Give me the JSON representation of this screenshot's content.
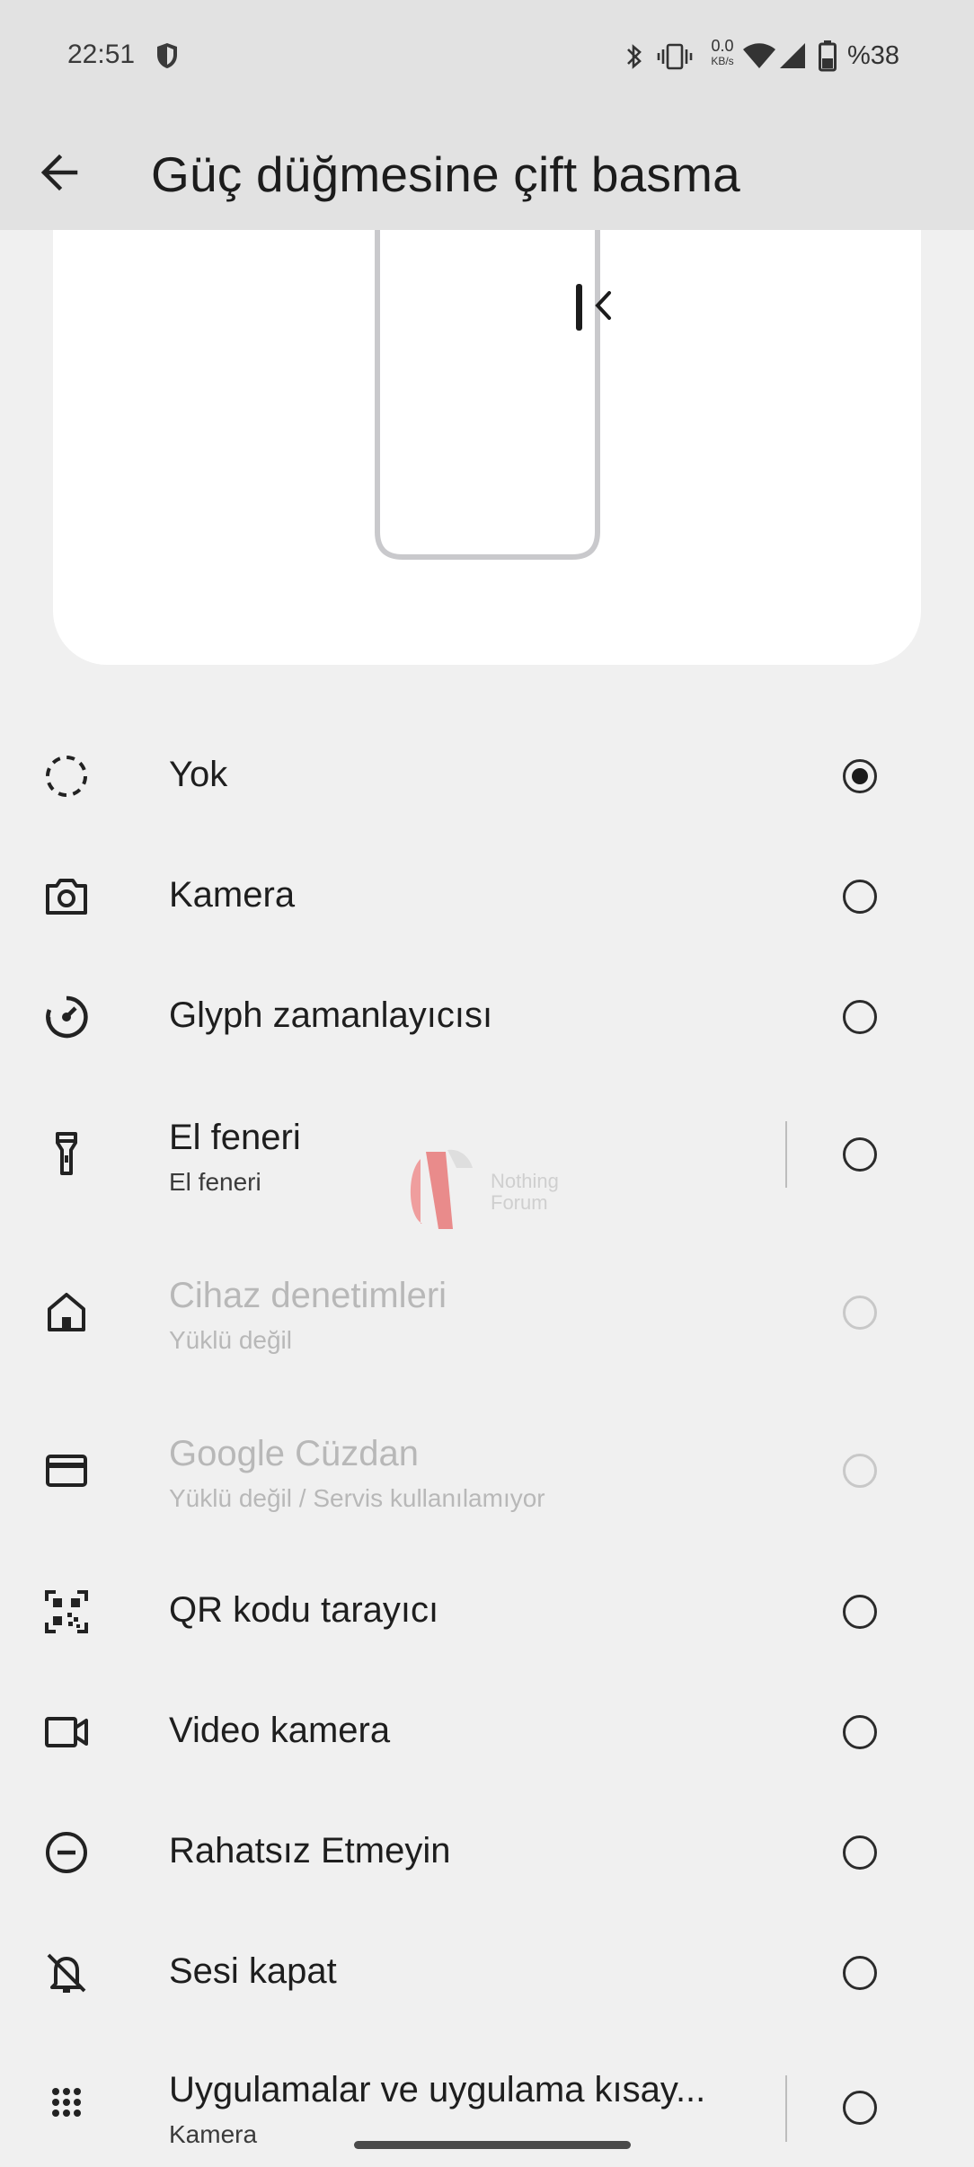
{
  "status_bar": {
    "time": "22:51",
    "net_speed_value": "0.0",
    "net_speed_unit": "KB/s",
    "battery": "%38",
    "icons": [
      "shield-icon",
      "bluetooth-icon",
      "vibrate-icon",
      "wifi-icon",
      "signal-icon",
      "battery-icon"
    ]
  },
  "header": {
    "title": "Güç düğmesine çift basma",
    "back_icon": "arrow-left-icon"
  },
  "options": [
    {
      "title": "Yok",
      "subtitle": "",
      "icon": "dashed-circle-icon",
      "selected": true,
      "enabled": true
    },
    {
      "title": "Kamera",
      "subtitle": "",
      "icon": "camera-icon",
      "selected": false,
      "enabled": true
    },
    {
      "title": "Glyph zamanlayıcısı",
      "subtitle": "",
      "icon": "timer-icon",
      "selected": false,
      "enabled": true
    },
    {
      "title": "El feneri",
      "subtitle": "El feneri",
      "icon": "flashlight-icon",
      "selected": false,
      "enabled": true
    },
    {
      "title": "Cihaz denetimleri",
      "subtitle": "Yüklü değil",
      "icon": "home-icon",
      "selected": false,
      "enabled": false
    },
    {
      "title": "Google Cüzdan",
      "subtitle": "Yüklü değil / Servis kullanılamıyor",
      "icon": "card-icon",
      "selected": false,
      "enabled": false
    },
    {
      "title": "QR kodu tarayıcı",
      "subtitle": "",
      "icon": "qr-code-icon",
      "selected": false,
      "enabled": true
    },
    {
      "title": "Video kamera",
      "subtitle": "",
      "icon": "video-camera-icon",
      "selected": false,
      "enabled": true
    },
    {
      "title": "Rahatsız Etmeyin",
      "subtitle": "",
      "icon": "do-not-disturb-icon",
      "selected": false,
      "enabled": true
    },
    {
      "title": "Sesi kapat",
      "subtitle": "",
      "icon": "bell-off-icon",
      "selected": false,
      "enabled": true
    },
    {
      "title": "Uygulamalar ve uygulama kısay...",
      "subtitle": "Kamera",
      "icon": "apps-grid-icon",
      "selected": false,
      "enabled": true
    }
  ],
  "watermark": {
    "line1": "Nothing",
    "line2": "Forum"
  },
  "colors": {
    "background": "#f0f0f0",
    "header": "#e2e2e2",
    "card": "#ffffff",
    "text": "#1e1e1e",
    "disabled": "#b8b8b8"
  }
}
